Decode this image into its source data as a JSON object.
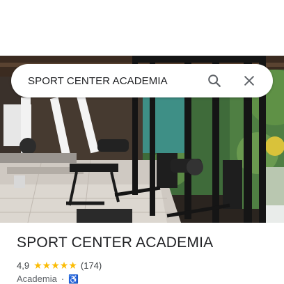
{
  "search": {
    "query": "SPORT CENTER ACADEMIA",
    "search_icon": "search-icon",
    "clear_icon": "close-icon"
  },
  "place": {
    "name": "SPORT CENTER ACADEMIA",
    "rating": "4,9",
    "stars": 5,
    "review_count": "(174)",
    "category": "Academia",
    "separator": "·",
    "accessibility_icon": "wheelchair-icon"
  },
  "colors": {
    "star": "#fbbc04",
    "accent": "#1a73e8",
    "text_primary": "#202124",
    "text_secondary": "#5f6368"
  }
}
